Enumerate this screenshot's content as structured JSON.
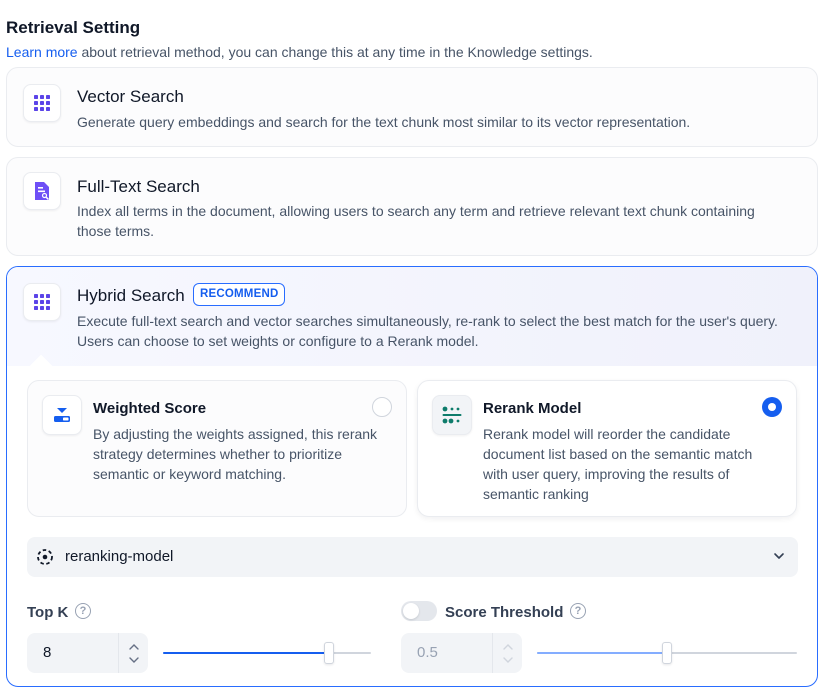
{
  "header": {
    "title": "Retrieval Setting",
    "learn_more": "Learn more",
    "subtitle_rest": " about retrieval method, you can change this at any time in the Knowledge settings."
  },
  "methods": {
    "vector": {
      "title": "Vector Search",
      "description": "Generate query embeddings and search for the text chunk most similar to its vector representation.",
      "icon": "grid-icon"
    },
    "fulltext": {
      "title": "Full-Text Search",
      "description": "Index all terms in the document, allowing users to search any term and retrieve relevant text chunk containing those terms.",
      "icon": "document-search-icon"
    },
    "hybrid": {
      "title": "Hybrid Search",
      "badge": "RECOMMEND",
      "description": "Execute full-text search and vector searches simultaneously, re-rank to select the best match for the user's query. Users can choose to set weights or configure to a Rerank model.",
      "icon": "grid-icon",
      "selected": true
    }
  },
  "hybrid_options": {
    "weighted": {
      "title": "Weighted Score",
      "description": "By adjusting the weights assigned, this rerank strategy determines whether to prioritize semantic or keyword matching.",
      "selected": false
    },
    "rerank": {
      "title": "Rerank Model",
      "description": "Rerank model will reorder the candidate document list based on the semantic match with user query, improving the results of semantic ranking",
      "selected": true
    }
  },
  "rerank_model": {
    "name": "reranking-model"
  },
  "params": {
    "top_k": {
      "label": "Top K",
      "value": "8",
      "slider_fraction": 0.8
    },
    "score_threshold": {
      "label": "Score Threshold",
      "value": "0.5",
      "enabled": false,
      "slider_fraction": 0.5
    }
  },
  "colors": {
    "accent": "#155eef",
    "selected_border": "#296dff",
    "muted_text": "#475467"
  }
}
